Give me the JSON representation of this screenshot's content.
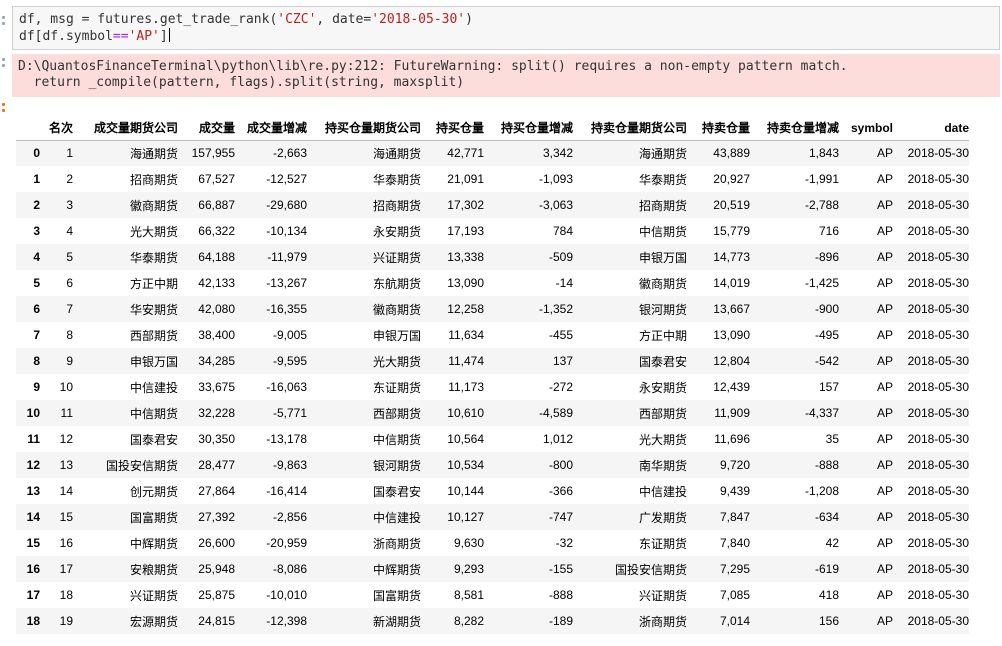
{
  "code": {
    "line1": {
      "pre": "df, msg = futures.get_trade_rank(",
      "arg1": "'CZC'",
      "mid": ", date=",
      "arg2": "'2018-05-30'",
      "post": ")"
    },
    "line2": {
      "pre": "df[df.symbol",
      "op": "==",
      "str": "'AP'",
      "post": "]"
    }
  },
  "stderr": {
    "line1": "D:\\QuantosFinanceTerminal\\python\\lib\\re.py:212: FutureWarning: split() requires a non-empty pattern match.",
    "line2": "  return _compile(pattern, flags).split(string, maxsplit)"
  },
  "table": {
    "columns": [
      "",
      "名次",
      "成交量期货公司",
      "成交量",
      "成交量增减",
      "持买仓量期货公司",
      "持买仓量",
      "持买仓量增减",
      "持卖仓量期货公司",
      "持卖仓量",
      "持卖仓量增减",
      "symbol",
      "date"
    ],
    "rows": [
      [
        "0",
        "1",
        "海通期货",
        "157,955",
        "-2,663",
        "海通期货",
        "42,771",
        "3,342",
        "海通期货",
        "43,889",
        "1,843",
        "AP",
        "2018-05-30"
      ],
      [
        "1",
        "2",
        "招商期货",
        "67,527",
        "-12,527",
        "华泰期货",
        "21,091",
        "-1,093",
        "华泰期货",
        "20,927",
        "-1,991",
        "AP",
        "2018-05-30"
      ],
      [
        "2",
        "3",
        "徽商期货",
        "66,887",
        "-29,680",
        "招商期货",
        "17,302",
        "-3,063",
        "招商期货",
        "20,519",
        "-2,788",
        "AP",
        "2018-05-30"
      ],
      [
        "3",
        "4",
        "光大期货",
        "66,322",
        "-10,134",
        "永安期货",
        "17,193",
        "784",
        "中信期货",
        "15,779",
        "716",
        "AP",
        "2018-05-30"
      ],
      [
        "4",
        "5",
        "华泰期货",
        "64,188",
        "-11,979",
        "兴证期货",
        "13,338",
        "-509",
        "申银万国",
        "14,773",
        "-896",
        "AP",
        "2018-05-30"
      ],
      [
        "5",
        "6",
        "方正中期",
        "42,133",
        "-13,267",
        "东航期货",
        "13,090",
        "-14",
        "徽商期货",
        "14,019",
        "-1,425",
        "AP",
        "2018-05-30"
      ],
      [
        "6",
        "7",
        "华安期货",
        "42,080",
        "-16,355",
        "徽商期货",
        "12,258",
        "-1,352",
        "银河期货",
        "13,667",
        "-900",
        "AP",
        "2018-05-30"
      ],
      [
        "7",
        "8",
        "西部期货",
        "38,400",
        "-9,005",
        "申银万国",
        "11,634",
        "-455",
        "方正中期",
        "13,090",
        "-495",
        "AP",
        "2018-05-30"
      ],
      [
        "8",
        "9",
        "申银万国",
        "34,285",
        "-9,595",
        "光大期货",
        "11,474",
        "137",
        "国泰君安",
        "12,804",
        "-542",
        "AP",
        "2018-05-30"
      ],
      [
        "9",
        "10",
        "中信建投",
        "33,675",
        "-16,063",
        "东证期货",
        "11,173",
        "-272",
        "永安期货",
        "12,439",
        "157",
        "AP",
        "2018-05-30"
      ],
      [
        "10",
        "11",
        "中信期货",
        "32,228",
        "-5,771",
        "西部期货",
        "10,610",
        "-4,589",
        "西部期货",
        "11,909",
        "-4,337",
        "AP",
        "2018-05-30"
      ],
      [
        "11",
        "12",
        "国泰君安",
        "30,350",
        "-13,178",
        "中信期货",
        "10,564",
        "1,012",
        "光大期货",
        "11,696",
        "35",
        "AP",
        "2018-05-30"
      ],
      [
        "12",
        "13",
        "国投安信期货",
        "28,477",
        "-9,863",
        "银河期货",
        "10,534",
        "-800",
        "南华期货",
        "9,720",
        "-888",
        "AP",
        "2018-05-30"
      ],
      [
        "13",
        "14",
        "创元期货",
        "27,864",
        "-16,414",
        "国泰君安",
        "10,144",
        "-366",
        "中信建投",
        "9,439",
        "-1,208",
        "AP",
        "2018-05-30"
      ],
      [
        "14",
        "15",
        "国富期货",
        "27,392",
        "-2,856",
        "中信建投",
        "10,127",
        "-747",
        "广发期货",
        "7,847",
        "-634",
        "AP",
        "2018-05-30"
      ],
      [
        "15",
        "16",
        "中辉期货",
        "26,600",
        "-20,959",
        "浙商期货",
        "9,630",
        "-32",
        "东证期货",
        "7,840",
        "42",
        "AP",
        "2018-05-30"
      ],
      [
        "16",
        "17",
        "安粮期货",
        "25,948",
        "-8,086",
        "中辉期货",
        "9,293",
        "-155",
        "国投安信期货",
        "7,295",
        "-619",
        "AP",
        "2018-05-30"
      ],
      [
        "17",
        "18",
        "兴证期货",
        "25,875",
        "-10,010",
        "国富期货",
        "8,581",
        "-888",
        "兴证期货",
        "7,085",
        "418",
        "AP",
        "2018-05-30"
      ],
      [
        "18",
        "19",
        "宏源期货",
        "24,815",
        "-12,398",
        "新湖期货",
        "8,282",
        "-189",
        "浙商期货",
        "7,014",
        "156",
        "AP",
        "2018-05-30"
      ]
    ]
  },
  "colors": {
    "input_bg": "#f7f7f7",
    "stderr_bg": "#fddcdc",
    "string_token": "#ba2121",
    "operator_token": "#aa22ff",
    "row_stripe": "#f5f5f5"
  }
}
